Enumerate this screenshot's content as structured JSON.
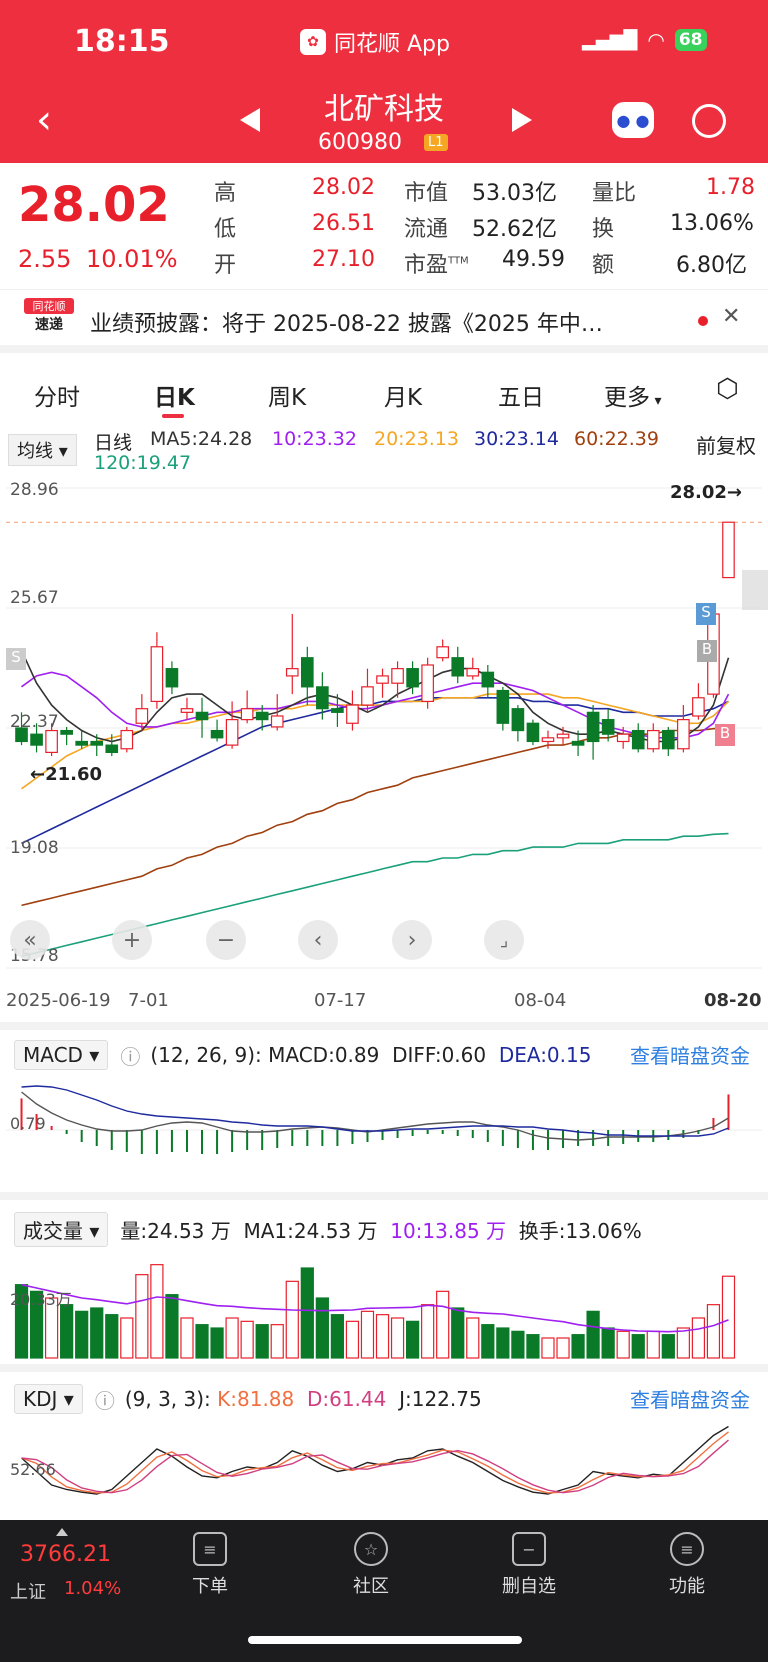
{
  "status_bar": {
    "time": "18:15",
    "app_name": "同花顺 App",
    "battery": "68"
  },
  "header": {
    "stock_name": "北矿科技",
    "stock_code": "600980",
    "level_badge": "L1"
  },
  "quote": {
    "price": "28.02",
    "change": "2.55",
    "change_pct": "10.01%",
    "high_label": "高",
    "high": "28.02",
    "low_label": "低",
    "low": "26.51",
    "open_label": "开",
    "open": "27.10",
    "mcap_label": "市值",
    "mcap": "53.03亿",
    "float_label": "流通",
    "float_cap": "52.62亿",
    "pe_label": "市盈",
    "pe_sup": "TTM",
    "pe": "49.59",
    "vr_label": "量比",
    "vr": "1.78",
    "turn_label": "换",
    "turn": "13.06%",
    "amt_label": "额",
    "amt": "6.80亿"
  },
  "news": {
    "badge_top": "同花顺",
    "badge_bottom": "速递",
    "text": "业绩预披露：将于 2025-08-22 披露《2025 年中…"
  },
  "tabs": [
    "分时",
    "日K",
    "周K",
    "月K",
    "五日",
    "更多"
  ],
  "active_tab": "日K",
  "ma_bar": {
    "select": "均线",
    "period": "日线",
    "ma5": "MA5:24.28",
    "ma10": "10:23.32",
    "ma20": "20:23.13",
    "ma30": "30:23.14",
    "ma60": "60:22.39",
    "ma120": "120:19.47",
    "adjust": "前复权"
  },
  "price_axis": [
    "28.96",
    "25.67",
    "22.37",
    "19.08",
    "15.78"
  ],
  "annotations": {
    "last_price": "28.02→",
    "low_mark": "←21.60",
    "s": "S",
    "b": "B"
  },
  "date_axis": [
    "2025-06-19",
    "7-01",
    "07-17",
    "08-04",
    "08-20"
  ],
  "macd": {
    "select": "MACD",
    "params": "(12, 26, 9):",
    "macd": "MACD:0.89",
    "diff": "DIFF:0.60",
    "dea": "DEA:0.15",
    "link": "查看暗盘资金",
    "axis": "0.79"
  },
  "volume": {
    "select": "成交量",
    "vol": "量:24.53 万",
    "ma1": "MA1:24.53 万",
    "ma10": "10:13.85 万",
    "turn": "换手:13.06%",
    "axis": "20.33万"
  },
  "kdj": {
    "select": "KDJ",
    "params": "(9, 3, 3):",
    "k": "K:81.88",
    "d": "D:61.44",
    "j": "J:122.75",
    "link": "查看暗盘资金",
    "axis": "52.66"
  },
  "bottom_nav": {
    "index_value": "3766.21",
    "index_name": "上证",
    "index_pct": "1.04%",
    "items": [
      "下单",
      "社区",
      "删自选",
      "功能"
    ]
  },
  "colors": {
    "brand": "#ee2f3f",
    "up": "#e8202b",
    "down": "#0a7a28",
    "ma5": "#333333",
    "ma10": "#a020f0",
    "ma20": "#f5a623",
    "ma30": "#1e2a9e",
    "ma60": "#a0400f",
    "ma120": "#1aa07a"
  },
  "chart_data": {
    "type": "candlestick",
    "candles": [
      [
        22.37,
        22.0,
        22.8,
        21.9
      ],
      [
        22.2,
        21.9,
        22.5,
        21.7
      ],
      [
        21.7,
        22.3,
        22.5,
        21.6
      ],
      [
        22.3,
        22.2,
        22.4,
        21.9
      ],
      [
        22.0,
        21.9,
        22.3,
        21.8
      ],
      [
        22.0,
        21.9,
        22.2,
        21.6
      ],
      [
        21.9,
        21.7,
        22.2,
        21.6
      ],
      [
        21.8,
        22.3,
        22.4,
        21.7
      ],
      [
        22.5,
        22.9,
        23.3,
        22.3
      ],
      [
        23.1,
        24.6,
        25.0,
        22.9
      ],
      [
        24.0,
        23.5,
        24.2,
        23.3
      ],
      [
        22.8,
        22.9,
        23.2,
        22.6
      ],
      [
        22.8,
        22.6,
        23.2,
        22.1
      ],
      [
        22.3,
        22.1,
        22.6,
        22.0
      ],
      [
        21.9,
        22.6,
        23.1,
        21.8
      ],
      [
        22.6,
        22.9,
        23.4,
        22.5
      ],
      [
        22.8,
        22.6,
        23.0,
        22.3
      ],
      [
        22.4,
        22.7,
        23.3,
        22.3
      ],
      [
        23.8,
        24.0,
        25.5,
        23.3
      ],
      [
        24.3,
        23.5,
        24.6,
        23.0
      ],
      [
        23.5,
        22.9,
        23.9,
        22.6
      ],
      [
        22.9,
        22.8,
        23.3,
        22.4
      ],
      [
        22.5,
        23.0,
        23.4,
        22.3
      ],
      [
        23.0,
        23.5,
        24.0,
        22.8
      ],
      [
        23.6,
        23.8,
        24.0,
        23.2
      ],
      [
        23.6,
        24.0,
        24.2,
        23.2
      ],
      [
        24.0,
        23.5,
        24.2,
        23.3
      ],
      [
        23.1,
        24.1,
        24.3,
        22.9
      ],
      [
        24.3,
        24.6,
        24.8,
        24.2
      ],
      [
        24.3,
        23.8,
        24.6,
        23.6
      ],
      [
        23.8,
        24.0,
        24.3,
        23.7
      ],
      [
        23.9,
        23.5,
        24.1,
        23.2
      ],
      [
        23.4,
        22.5,
        23.5,
        22.3
      ],
      [
        22.9,
        22.3,
        23.0,
        22.0
      ],
      [
        22.5,
        22.0,
        22.6,
        21.9
      ],
      [
        22.0,
        22.1,
        22.3,
        21.8
      ],
      [
        22.1,
        22.2,
        22.4,
        21.9
      ],
      [
        22.0,
        21.9,
        22.3,
        21.6
      ],
      [
        22.8,
        22.0,
        23.0,
        21.5
      ],
      [
        22.6,
        22.2,
        22.9,
        22.0
      ],
      [
        22.0,
        22.2,
        22.4,
        21.8
      ],
      [
        22.3,
        21.8,
        22.5,
        21.7
      ],
      [
        21.8,
        22.3,
        22.5,
        21.7
      ],
      [
        22.3,
        21.8,
        22.4,
        21.6
      ],
      [
        21.8,
        22.6,
        23.0,
        21.7
      ],
      [
        22.7,
        23.2,
        23.6,
        22.6
      ],
      [
        23.3,
        25.5,
        25.6,
        23.2
      ],
      [
        26.5,
        28.02,
        28.02,
        26.51
      ]
    ],
    "ma5": [
      24.5,
      23.6,
      23.0,
      22.6,
      22.3,
      22.1,
      22.0,
      22.1,
      22.3,
      22.8,
      23.2,
      23.3,
      23.3,
      23.0,
      22.7,
      22.6,
      22.7,
      22.8,
      23.0,
      23.2,
      23.3,
      23.2,
      23.0,
      22.8,
      23.0,
      23.3,
      23.5,
      23.7,
      23.9,
      24.0,
      24.0,
      23.8,
      23.6,
      23.3,
      22.8,
      22.5,
      22.3,
      22.2,
      22.2,
      22.3,
      22.2,
      22.1,
      22.0,
      22.0,
      22.1,
      22.4,
      23.0,
      24.3
    ],
    "ma10": [
      23.5,
      23.8,
      23.9,
      23.8,
      23.5,
      23.2,
      22.8,
      22.5,
      22.4,
      22.4,
      22.5,
      22.6,
      22.7,
      22.8,
      22.8,
      22.9,
      22.9,
      22.9,
      23.0,
      23.1,
      23.1,
      23.0,
      22.9,
      22.9,
      23.0,
      23.1,
      23.2,
      23.3,
      23.4,
      23.5,
      23.6,
      23.6,
      23.6,
      23.5,
      23.4,
      23.2,
      23.0,
      22.8,
      22.6,
      22.4,
      22.3,
      22.2,
      22.1,
      22.1,
      22.1,
      22.2,
      22.5,
      23.3
    ],
    "ma20": [
      20.7,
      21.0,
      21.3,
      21.6,
      21.8,
      22.0,
      22.1,
      22.2,
      22.3,
      22.4,
      22.5,
      22.5,
      22.6,
      22.7,
      22.8,
      22.8,
      22.9,
      22.9,
      22.9,
      23.0,
      23.0,
      23.0,
      23.0,
      23.0,
      23.0,
      23.1,
      23.1,
      23.1,
      23.2,
      23.2,
      23.2,
      23.3,
      23.3,
      23.3,
      23.3,
      23.3,
      23.2,
      23.2,
      23.1,
      23.0,
      22.9,
      22.8,
      22.7,
      22.6,
      22.5,
      22.5,
      22.7,
      23.1
    ],
    "ma30": [
      19.2,
      19.4,
      19.6,
      19.8,
      20.0,
      20.2,
      20.4,
      20.6,
      20.8,
      21.0,
      21.2,
      21.4,
      21.6,
      21.8,
      22.0,
      22.2,
      22.4,
      22.5,
      22.6,
      22.7,
      22.8,
      22.9,
      23.0,
      23.0,
      23.1,
      23.1,
      23.1,
      23.2,
      23.2,
      23.2,
      23.2,
      23.2,
      23.2,
      23.2,
      23.1,
      23.1,
      23.0,
      23.0,
      22.9,
      22.9,
      22.8,
      22.8,
      22.7,
      22.7,
      22.7,
      22.8,
      22.9,
      23.1
    ],
    "ma60": [
      17.5,
      17.6,
      17.7,
      17.8,
      17.9,
      18.0,
      18.1,
      18.2,
      18.3,
      18.5,
      18.6,
      18.8,
      18.9,
      19.1,
      19.2,
      19.4,
      19.5,
      19.7,
      19.8,
      20.0,
      20.1,
      20.3,
      20.4,
      20.6,
      20.7,
      20.8,
      21.0,
      21.1,
      21.2,
      21.3,
      21.4,
      21.5,
      21.6,
      21.7,
      21.8,
      21.9,
      21.9,
      22.0,
      22.1,
      22.1,
      22.2,
      22.2,
      22.2,
      22.3,
      22.3,
      22.3,
      22.35,
      22.39
    ],
    "ma120": [
      16.1,
      16.2,
      16.3,
      16.4,
      16.5,
      16.6,
      16.7,
      16.8,
      16.9,
      17.0,
      17.1,
      17.2,
      17.3,
      17.4,
      17.5,
      17.6,
      17.7,
      17.8,
      17.9,
      18.0,
      18.1,
      18.2,
      18.3,
      18.4,
      18.5,
      18.6,
      18.7,
      18.7,
      18.8,
      18.8,
      18.9,
      18.9,
      19.0,
      19.0,
      19.1,
      19.1,
      19.1,
      19.2,
      19.2,
      19.2,
      19.3,
      19.3,
      19.3,
      19.3,
      19.4,
      19.4,
      19.45,
      19.47
    ],
    "ylim": [
      15.78,
      28.96
    ],
    "macd_hist": [
      0.79,
      0.4,
      0.1,
      -0.1,
      -0.3,
      -0.4,
      -0.5,
      -0.55,
      -0.6,
      -0.6,
      -0.55,
      -0.55,
      -0.6,
      -0.6,
      -0.55,
      -0.5,
      -0.5,
      -0.45,
      -0.4,
      -0.4,
      -0.4,
      -0.4,
      -0.35,
      -0.3,
      -0.25,
      -0.2,
      -0.15,
      -0.1,
      -0.1,
      -0.15,
      -0.2,
      -0.3,
      -0.4,
      -0.45,
      -0.5,
      -0.5,
      -0.45,
      -0.4,
      -0.4,
      -0.4,
      -0.35,
      -0.3,
      -0.3,
      -0.25,
      -0.2,
      -0.1,
      0.3,
      0.89
    ],
    "volume": [
      22,
      20,
      18,
      16,
      14,
      15,
      13,
      12,
      25,
      28,
      19,
      12,
      10,
      9,
      12,
      11,
      10,
      10,
      23,
      27,
      18,
      13,
      11,
      14,
      13,
      12,
      11,
      16,
      20,
      15,
      12,
      10,
      9,
      8,
      7,
      6,
      6,
      7,
      14,
      9,
      8,
      7,
      8,
      7,
      9,
      12,
      16,
      24.53
    ]
  }
}
